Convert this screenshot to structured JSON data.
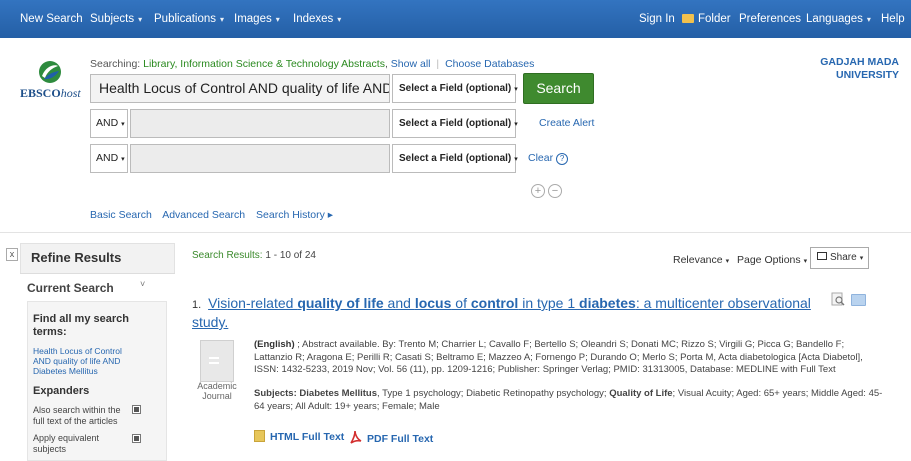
{
  "nav": {
    "new_search": "New Search",
    "subjects": "Subjects",
    "publications": "Publications",
    "images": "Images",
    "indexes": "Indexes",
    "sign_in": "Sign In",
    "folder": "Folder",
    "preferences": "Preferences",
    "languages": "Languages",
    "help": "Help",
    "caret": "▾"
  },
  "logo": {
    "text_bold": "EBSCO",
    "text_italic": "host"
  },
  "search": {
    "searching_label": "Searching:",
    "database": "Library, Information Science & Technology Abstracts",
    "show_all": "Show all",
    "choose_databases": "Choose Databases",
    "query": "Health Locus of Control AND quality of life AND Di:",
    "field_select": "Select a Field (optional)",
    "bool_op": "AND",
    "button": "Search",
    "create_alert": "Create Alert",
    "clear": "Clear",
    "help_symbol": "?",
    "add_row": "+",
    "remove_row": "−"
  },
  "institution": {
    "line1": "GADJAH MADA",
    "line2": "UNIVERSITY"
  },
  "search_links": {
    "basic": "Basic Search",
    "advanced": "Advanced Search",
    "history": "Search History ▸"
  },
  "refine": {
    "close": "x",
    "title": "Refine Results",
    "current_search": "Current Search",
    "chevron": "˅",
    "find_all": "Find all my search terms:",
    "terms": "Health Locus of Control AND quality of life AND Diabetes Mellitus",
    "expanders": "Expanders",
    "expander_1": "Also search within the full text of the articles",
    "expander_2": "Apply equivalent subjects"
  },
  "results": {
    "label": "Search Results:",
    "range": "1 - 10 of 24",
    "sort": "Relevance",
    "page_options": "Page Options",
    "share": "Share"
  },
  "record": {
    "number": "1.",
    "title_parts": [
      {
        "t": "Vision-related ",
        "b": false
      },
      {
        "t": "quality of life",
        "b": true
      },
      {
        "t": " and ",
        "b": false
      },
      {
        "t": "locus",
        "b": true
      },
      {
        "t": " of ",
        "b": false
      },
      {
        "t": "control",
        "b": true
      },
      {
        "t": " in type 1 ",
        "b": false
      },
      {
        "t": "diabetes",
        "b": true
      },
      {
        "t": ": a multicenter observational study.",
        "b": false
      }
    ],
    "language": "(English)",
    "details": " ; Abstract available. By: Trento M; Charrier L; Cavallo F; Bertello S; Oleandri S; Donati MC; Rizzo S; Virgili G; Picca G; Bandello F; Lattanzio R; Aragona E; Perilli R; Casati S; Beltramo E; Mazzeo A; Fornengo P; Durando O; Merlo S; Porta M, Acta diabetologica [Acta Diabetol], ISSN: 1432-5233, 2019 Nov; Vol. 56 (11), pp. 1209-1216; Publisher: Springer Verlag; PMID: 31313005, Database: MEDLINE with Full Text",
    "doc_type_1": "Academic",
    "doc_type_2": "Journal",
    "subjects_label": "Subjects:",
    "subject_main": "Diabetes Mellitus",
    "subjects_mid": ", Type 1 psychology; Diabetic Retinopathy psychology; ",
    "subject_bold2": "Quality of Life",
    "subjects_rest": "; Visual Acuity; Aged: 65+ years; Middle Aged: 45-64 years; All Adult: 19+ years; Female; Male",
    "html_full_text": "HTML Full Text",
    "pdf_full_text": "PDF Full Text"
  },
  "colors": {
    "nav_blue": "#2b6bb5",
    "link_blue": "#2767b0",
    "search_green": "#3f8a2f",
    "db_green": "#2a8a1f"
  }
}
